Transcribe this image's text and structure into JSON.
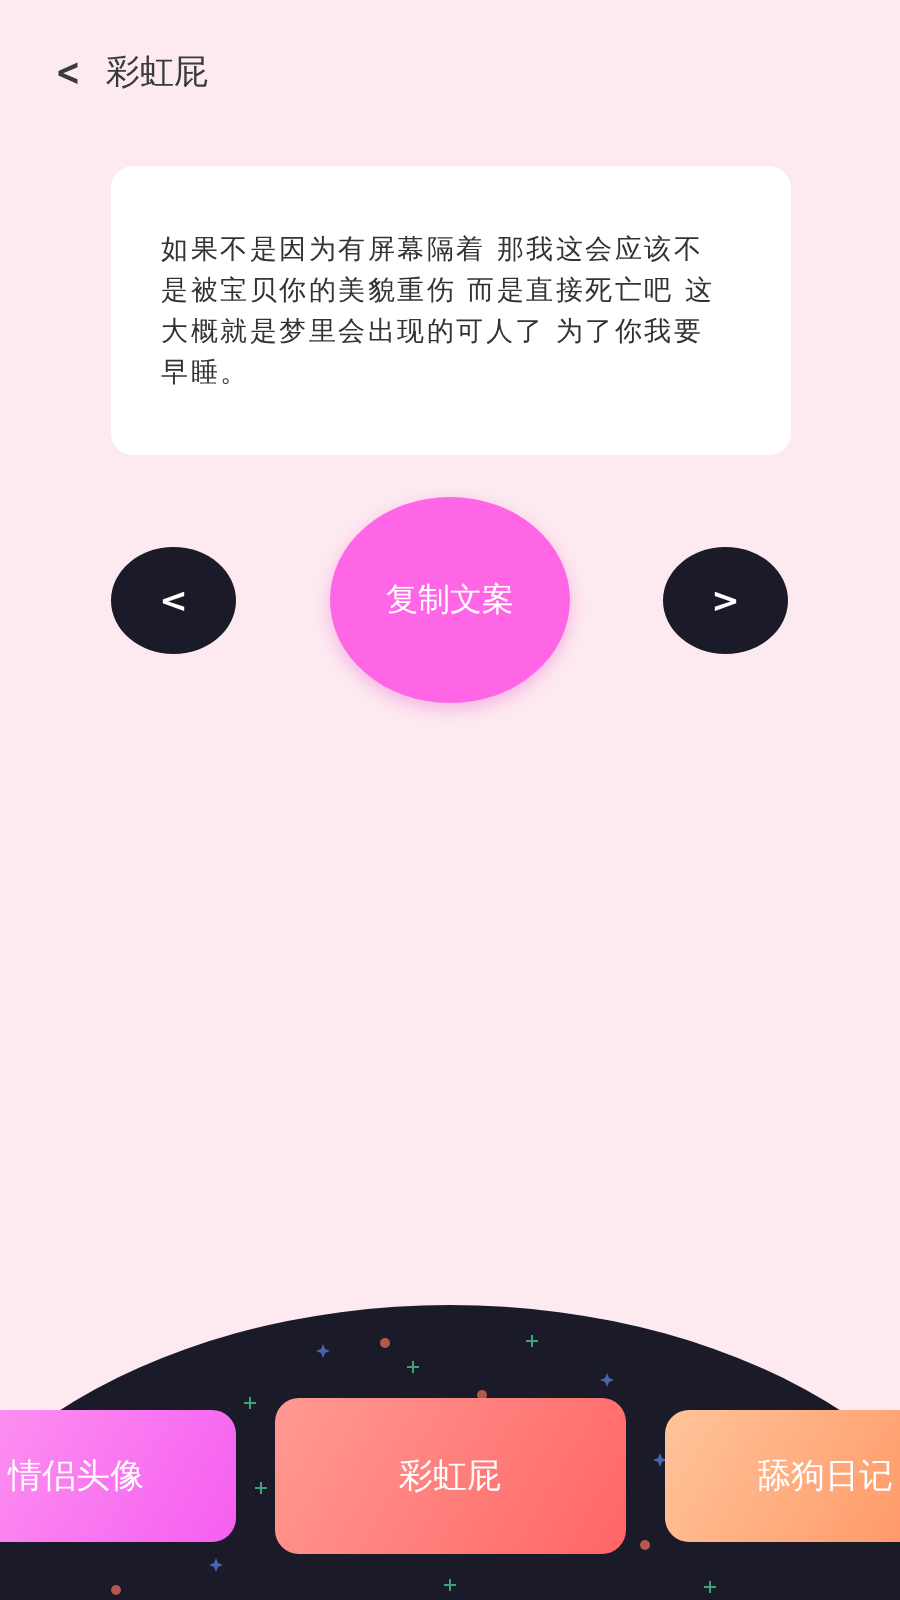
{
  "header": {
    "back": "<",
    "title": "彩虹屁"
  },
  "card": {
    "text": "如果不是因为有屏幕隔着 那我这会应该不是被宝贝你的美貌重伤 而是直接死亡吧 这大概就是梦里会出现的可人了 为了你我要早睡。"
  },
  "controls": {
    "prev": "<",
    "copy": "复制文案",
    "next": ">"
  },
  "tabs": [
    {
      "label": "情侣头像",
      "selected": false,
      "kind": "pink"
    },
    {
      "label": "彩虹屁",
      "selected": true,
      "kind": "coral"
    },
    {
      "label": "舔狗日记",
      "selected": false,
      "kind": "orange"
    }
  ]
}
